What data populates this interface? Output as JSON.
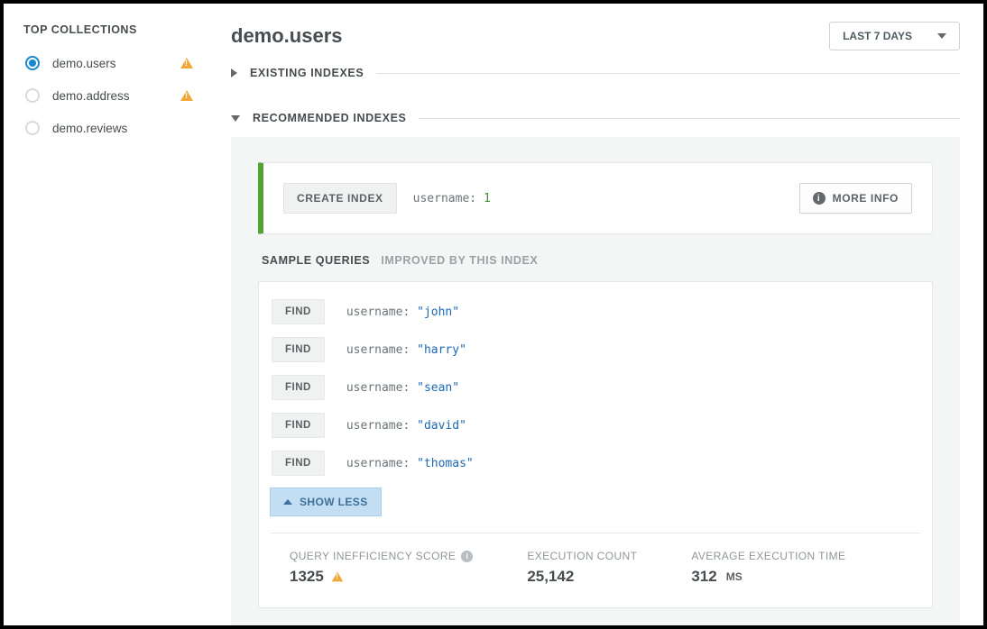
{
  "sidebar": {
    "title": "TOP COLLECTIONS",
    "items": [
      {
        "name": "demo.users",
        "selected": true,
        "warn": true
      },
      {
        "name": "demo.address",
        "selected": false,
        "warn": true
      },
      {
        "name": "demo.reviews",
        "selected": false,
        "warn": false
      }
    ]
  },
  "page": {
    "title": "demo.users",
    "range_dropdown": "LAST 7 DAYS"
  },
  "sections": {
    "existing": "EXISTING INDEXES",
    "recommended": "RECOMMENDED INDEXES"
  },
  "index_card": {
    "create_label": "CREATE INDEX",
    "key": "username:",
    "value": "1",
    "more_info": "MORE INFO"
  },
  "sample": {
    "head1": "SAMPLE QUERIES",
    "head2": "IMPROVED BY THIS INDEX",
    "op_label": "FIND",
    "key": "username:",
    "queries": [
      "\"john\"",
      "\"harry\"",
      "\"sean\"",
      "\"david\"",
      "\"thomas\""
    ],
    "show_less": "SHOW LESS"
  },
  "stats": {
    "s1_label": "QUERY INEFFICIENCY SCORE",
    "s1_value": "1325",
    "s2_label": "EXECUTION COUNT",
    "s2_value": "25,142",
    "s3_label": "AVERAGE EXECUTION TIME",
    "s3_value": "312",
    "s3_unit": "MS"
  }
}
